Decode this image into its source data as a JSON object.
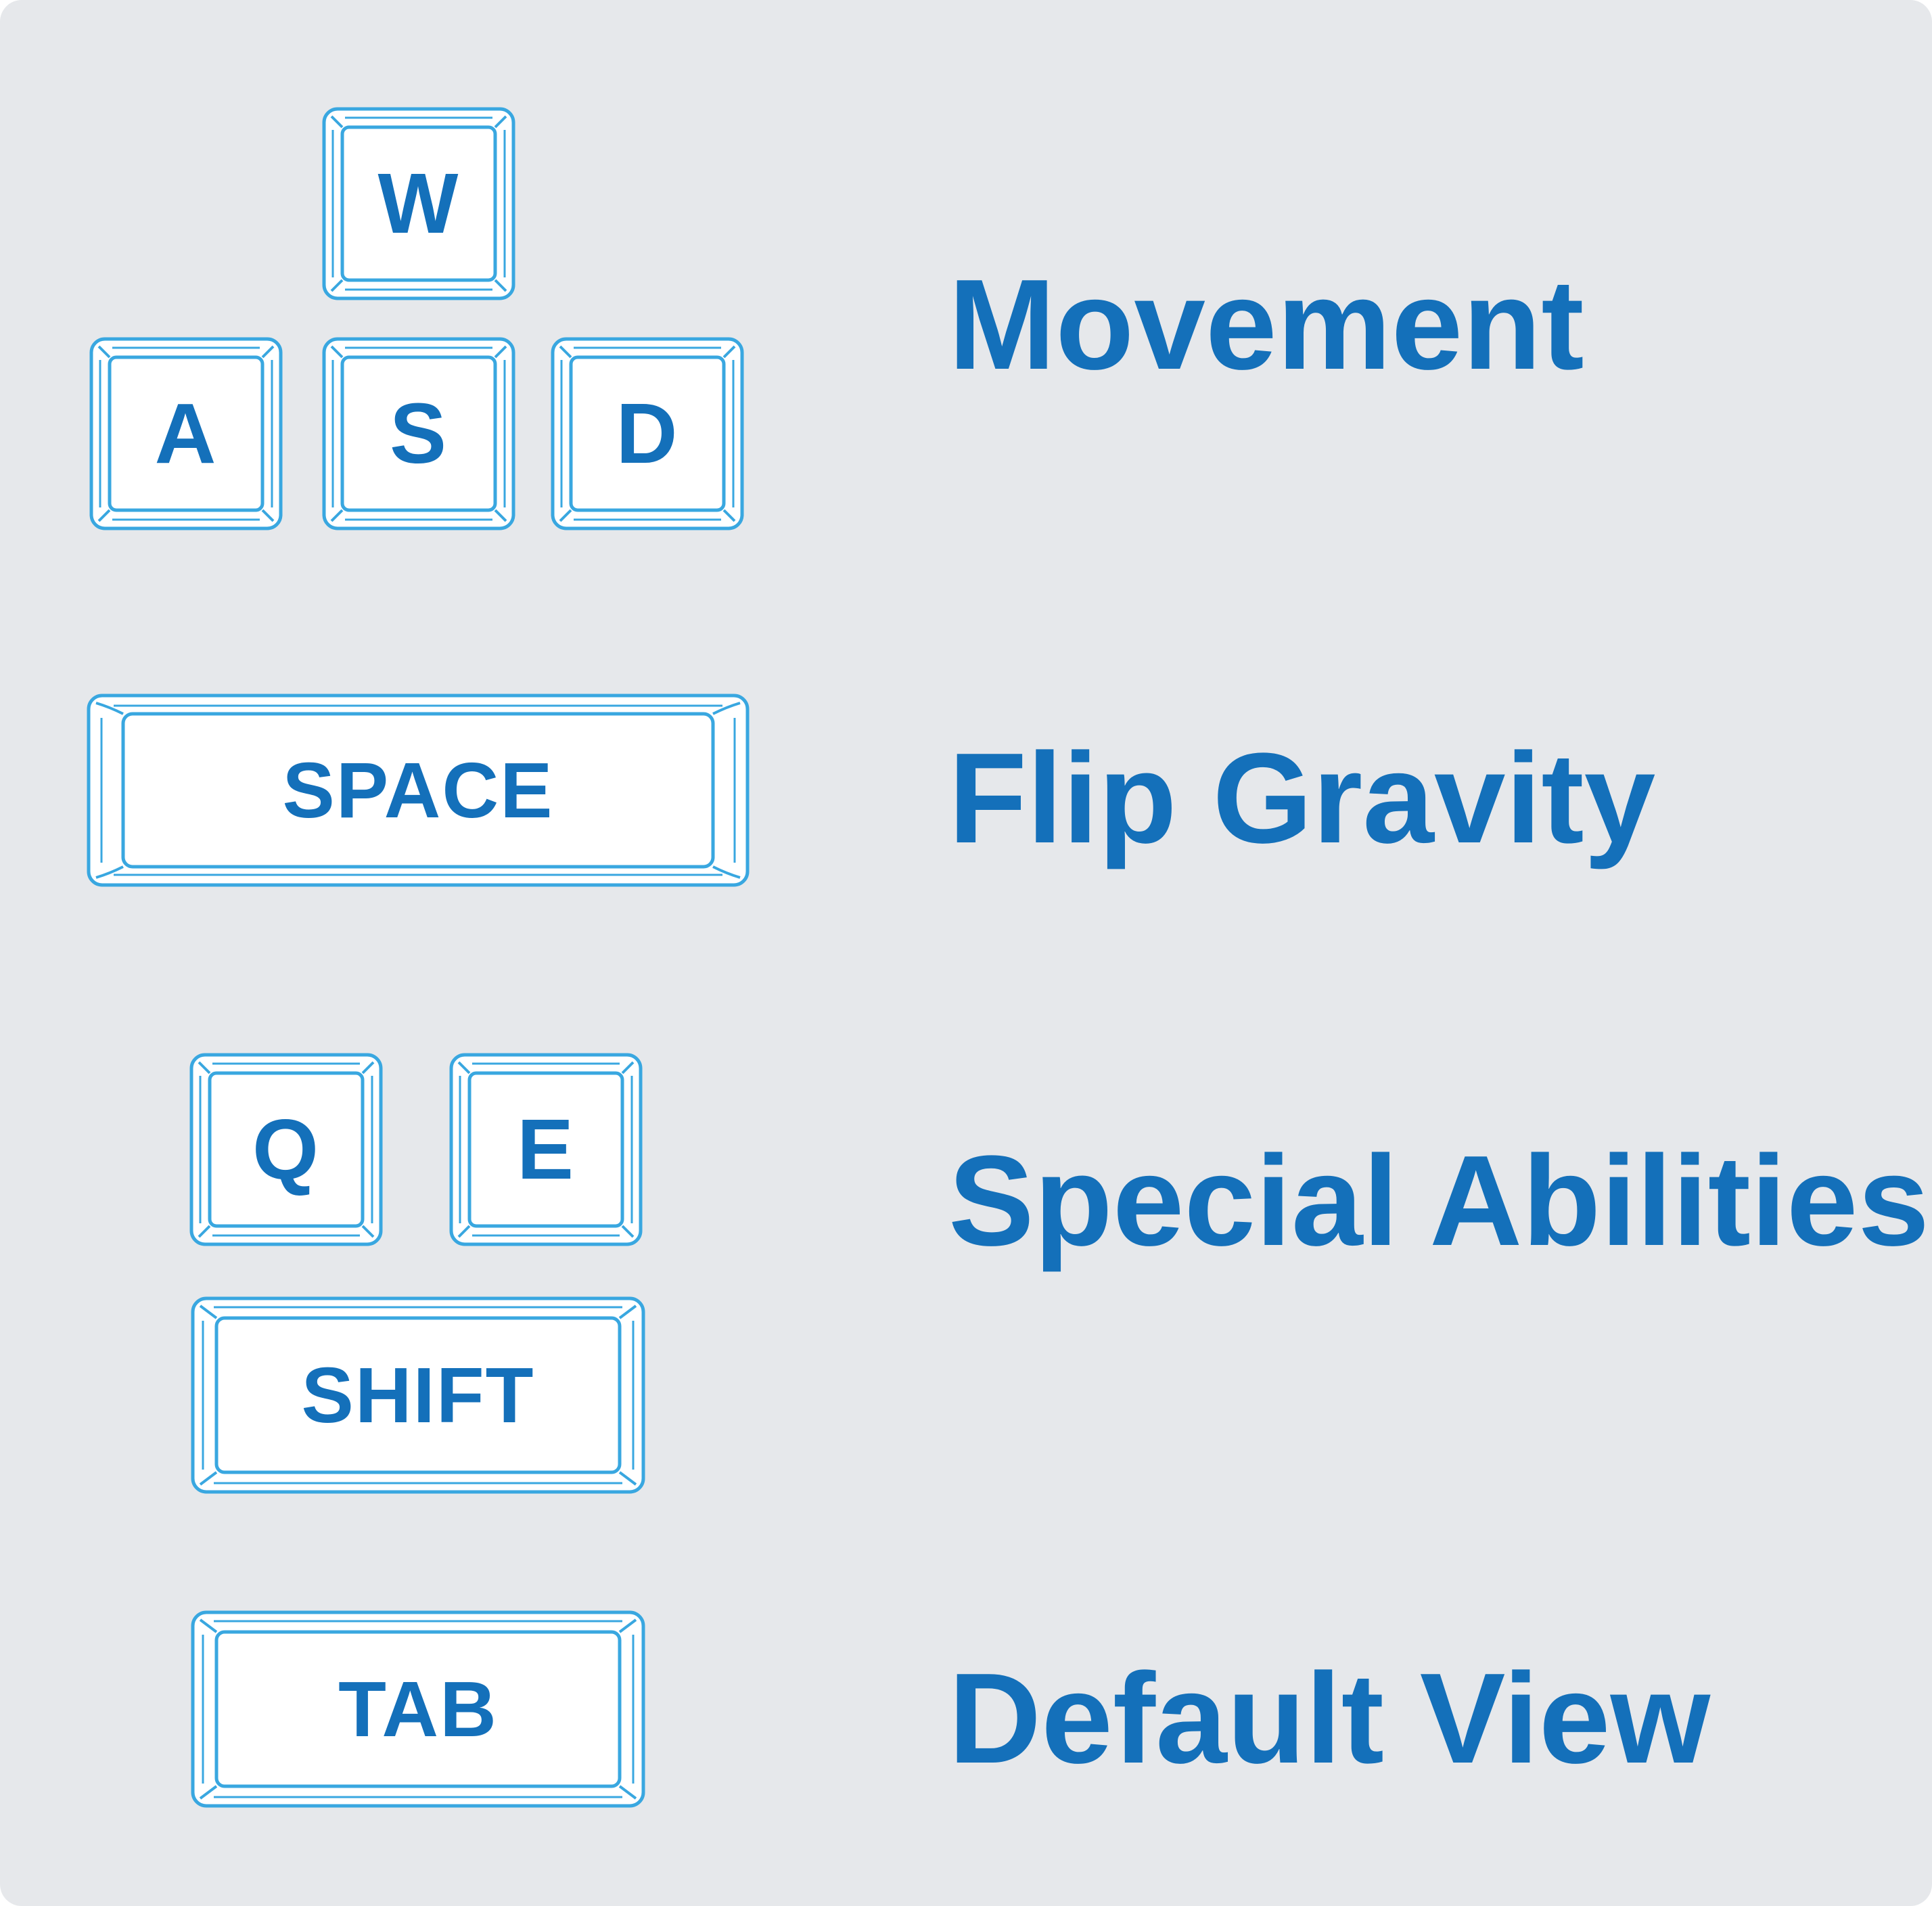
{
  "colors": {
    "panel_background": "#e6e8eb",
    "key_face": "#ffffff",
    "key_outline": "#39a7e0",
    "text": "#1470ba"
  },
  "controls": [
    {
      "action": "Movement",
      "keys": [
        "W",
        "A",
        "S",
        "D"
      ]
    },
    {
      "action": "Flip Gravity",
      "keys": [
        "SPACE"
      ]
    },
    {
      "action": "Special Abilities",
      "keys": [
        "Q",
        "E",
        "SHIFT"
      ]
    },
    {
      "action": "Default View",
      "keys": [
        "TAB"
      ]
    }
  ]
}
